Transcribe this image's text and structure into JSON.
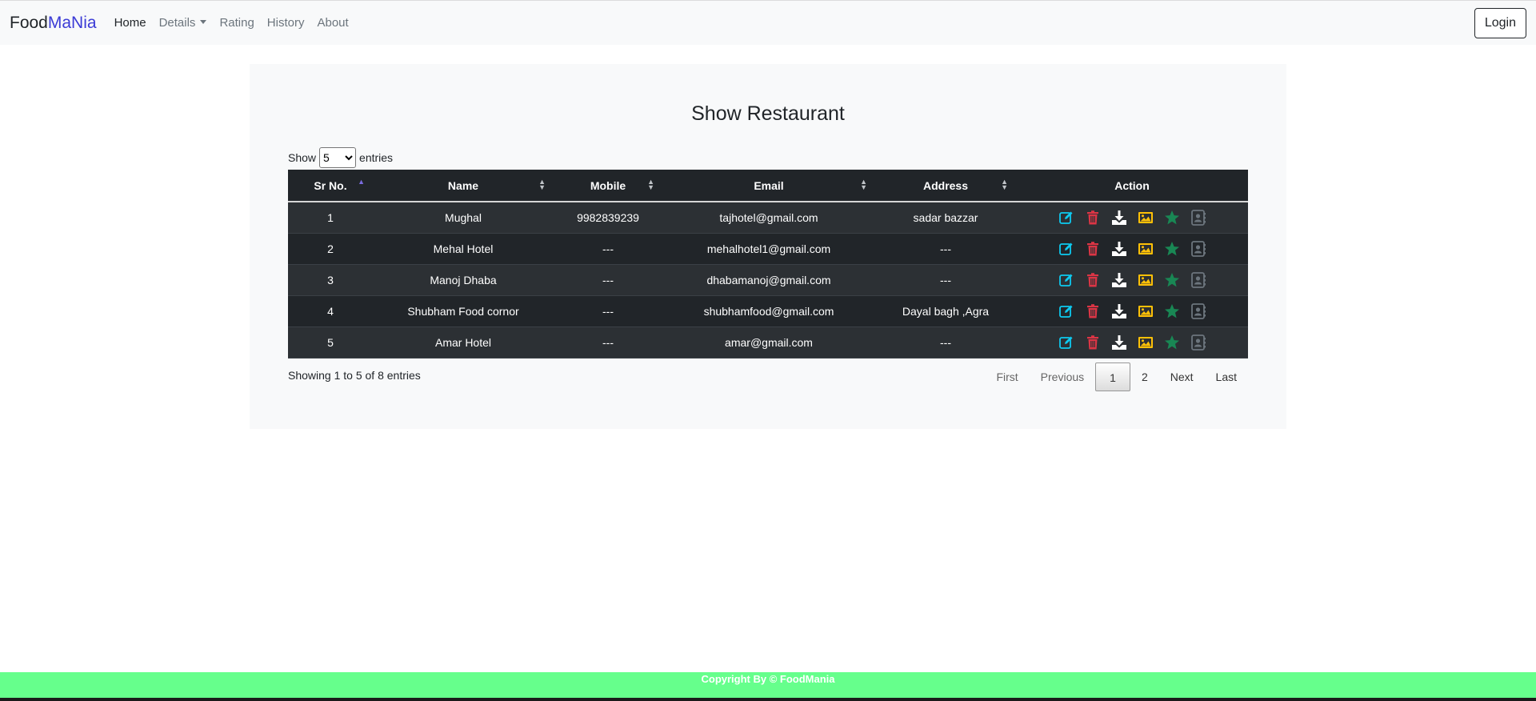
{
  "navbar": {
    "brand_part1": "Food",
    "brand_part2": "MaNia",
    "links": [
      "Home",
      "Details",
      "Rating",
      "History",
      "About"
    ],
    "login_label": "Login"
  },
  "page": {
    "title": "Show Restaurant",
    "show_label": "Show",
    "entries_label": "entries",
    "page_length": "5",
    "info": "Showing 1 to 5 of 8 entries"
  },
  "table": {
    "headers": [
      "Sr No.",
      "Name",
      "Mobile",
      "Email",
      "Address",
      "Action"
    ],
    "rows": [
      {
        "sr": "1",
        "name": "Mughal",
        "mobile": "9982839239",
        "email": "tajhotel@gmail.com",
        "address": "sadar bazzar"
      },
      {
        "sr": "2",
        "name": "Mehal Hotel",
        "mobile": "---",
        "email": "mehalhotel1@gmail.com",
        "address": "---"
      },
      {
        "sr": "3",
        "name": "Manoj Dhaba",
        "mobile": "---",
        "email": "dhabamanoj@gmail.com",
        "address": "---"
      },
      {
        "sr": "4",
        "name": "Shubham Food cornor",
        "mobile": "---",
        "email": "shubhamfood@gmail.com",
        "address": "Dayal bagh ,Agra"
      },
      {
        "sr": "5",
        "name": "Amar Hotel",
        "mobile": "---",
        "email": "amar@gmail.com",
        "address": "---"
      }
    ],
    "action_icons": [
      "edit-icon",
      "trash-icon",
      "download-icon",
      "image-icon",
      "star-icon",
      "contact-book-icon"
    ]
  },
  "pagination": {
    "first": "First",
    "previous": "Previous",
    "pages": [
      "1",
      "2"
    ],
    "next": "Next",
    "last": "Last"
  },
  "footer": {
    "text": "Copyright By © FoodMania"
  },
  "colors": {
    "edit": "#0dcaf0",
    "trash": "#dc3545",
    "download": "#ffffff",
    "image": "#ffc107",
    "star": "#198754",
    "contact": "#6c757d",
    "footer_bg": "#66ff8c"
  }
}
